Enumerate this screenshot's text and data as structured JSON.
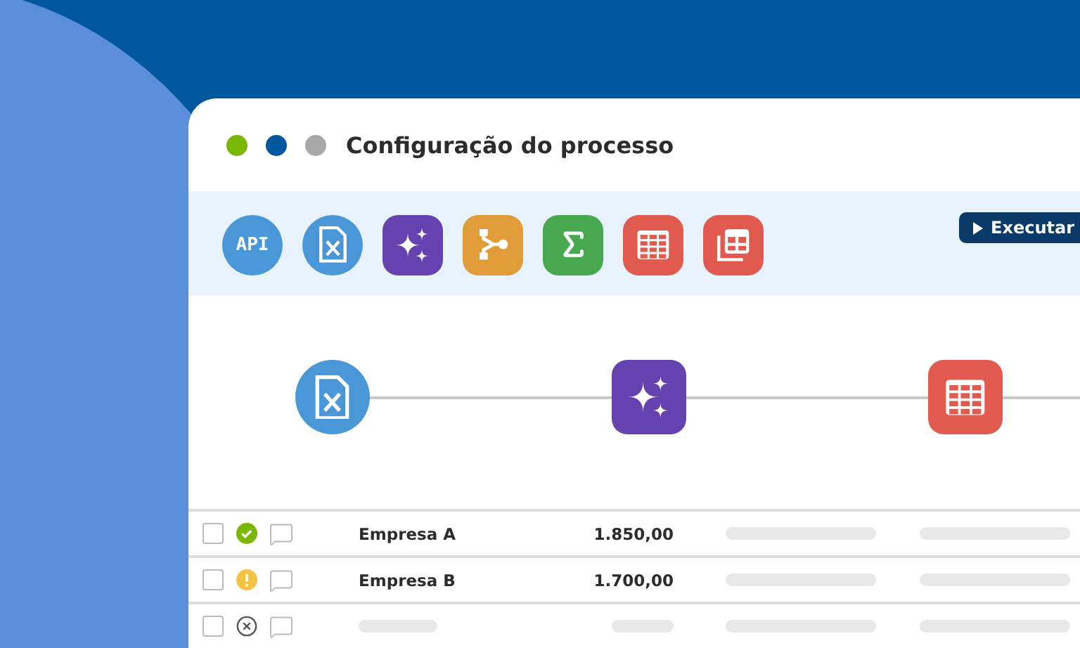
{
  "window": {
    "title": "Configuração do processo",
    "dots": [
      {
        "color": "#7ab800"
      },
      {
        "color": "#00579e"
      },
      {
        "color": "#a8a8a8"
      }
    ]
  },
  "toolbar": {
    "tools": [
      {
        "kind": "api",
        "label": "API"
      },
      {
        "kind": "spreadsheet"
      },
      {
        "kind": "ai"
      },
      {
        "kind": "branch"
      },
      {
        "kind": "sum"
      },
      {
        "kind": "table"
      },
      {
        "kind": "tables"
      }
    ],
    "run_button": "Executar"
  },
  "flow": {
    "nodes": [
      {
        "kind": "spreadsheet"
      },
      {
        "kind": "ai"
      },
      {
        "kind": "table"
      }
    ]
  },
  "rows": [
    {
      "checked": false,
      "kind": "ok",
      "name": "Empresa A",
      "amount": "1.850,00"
    },
    {
      "checked": false,
      "kind": "warning",
      "name": "Empresa B",
      "amount": "1.700,00"
    },
    {
      "checked": false,
      "kind": "error"
    }
  ]
}
